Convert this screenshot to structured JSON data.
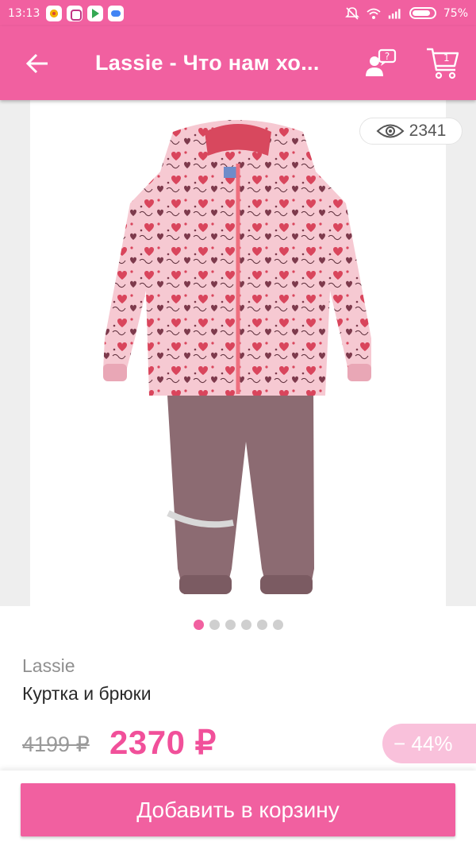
{
  "status_bar": {
    "time": "13:13",
    "battery": "75%",
    "apps": [
      "chrome-icon",
      "instagram-icon",
      "play-store-icon",
      "cloud-icon"
    ]
  },
  "app_bar": {
    "title": "Lassie - Что нам хо...",
    "cart_count": "1",
    "color": "#f160a0"
  },
  "gallery": {
    "views": "2341",
    "image_count": 6,
    "active_index": 0
  },
  "product": {
    "brand": "Lassie",
    "name": "Куртка и брюки",
    "old_price": "4199 ₽",
    "price": "2370 ₽",
    "discount": "− 44%"
  },
  "actions": {
    "add_to_cart": "Добавить в корзину"
  }
}
